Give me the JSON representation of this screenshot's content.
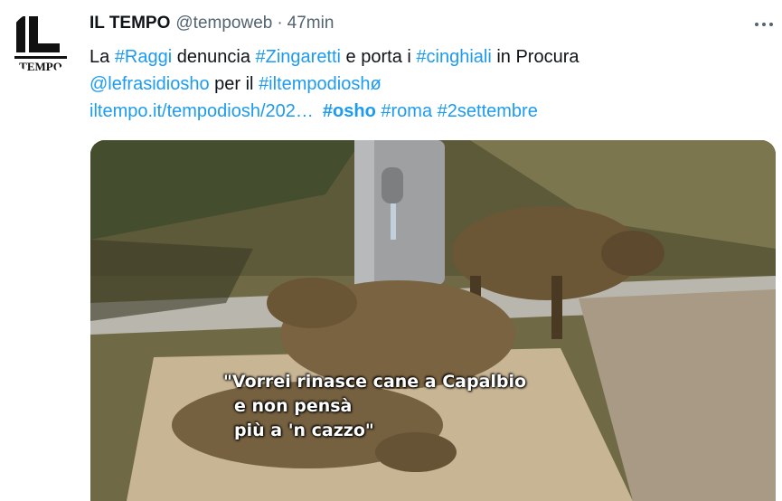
{
  "author": {
    "name": "IL TEMPO",
    "handle": "@tempoweb",
    "separator": "·",
    "time": "47min",
    "avatar_text_top": "IL",
    "avatar_text_bottom": "TEMPO"
  },
  "tweet": {
    "line1": [
      {
        "text": "La ",
        "link": false
      },
      {
        "text": "#Raggi",
        "link": true
      },
      {
        "text": " denuncia ",
        "link": false
      },
      {
        "text": "#Zingaretti",
        "link": true
      },
      {
        "text": " e porta i ",
        "link": false
      },
      {
        "text": "#cinghiali",
        "link": true
      },
      {
        "text": " in Procura",
        "link": false
      }
    ],
    "line2": [
      {
        "text": "@lefrasidiosho",
        "link": true
      },
      {
        "text": " per il ",
        "link": false
      },
      {
        "text": "#iltempodioshø",
        "link": true
      }
    ],
    "line3": [
      {
        "text": "iltempo.it/tempodiosh/202…",
        "link": true
      },
      {
        "text": "#osho",
        "link": true
      },
      {
        "text": "#roma",
        "link": true
      },
      {
        "text": "#2settembre",
        "link": true
      }
    ]
  },
  "media": {
    "caption_line1": "\"Vorrei rinasce cane a Capalbio",
    "caption_line2": "e non pensà",
    "caption_line3": "più a 'n cazzo\""
  },
  "icons": {
    "more": "more-horizontal-icon"
  },
  "colors": {
    "link": "#1d9bf0",
    "text": "#0f1419",
    "muted": "#536471"
  }
}
